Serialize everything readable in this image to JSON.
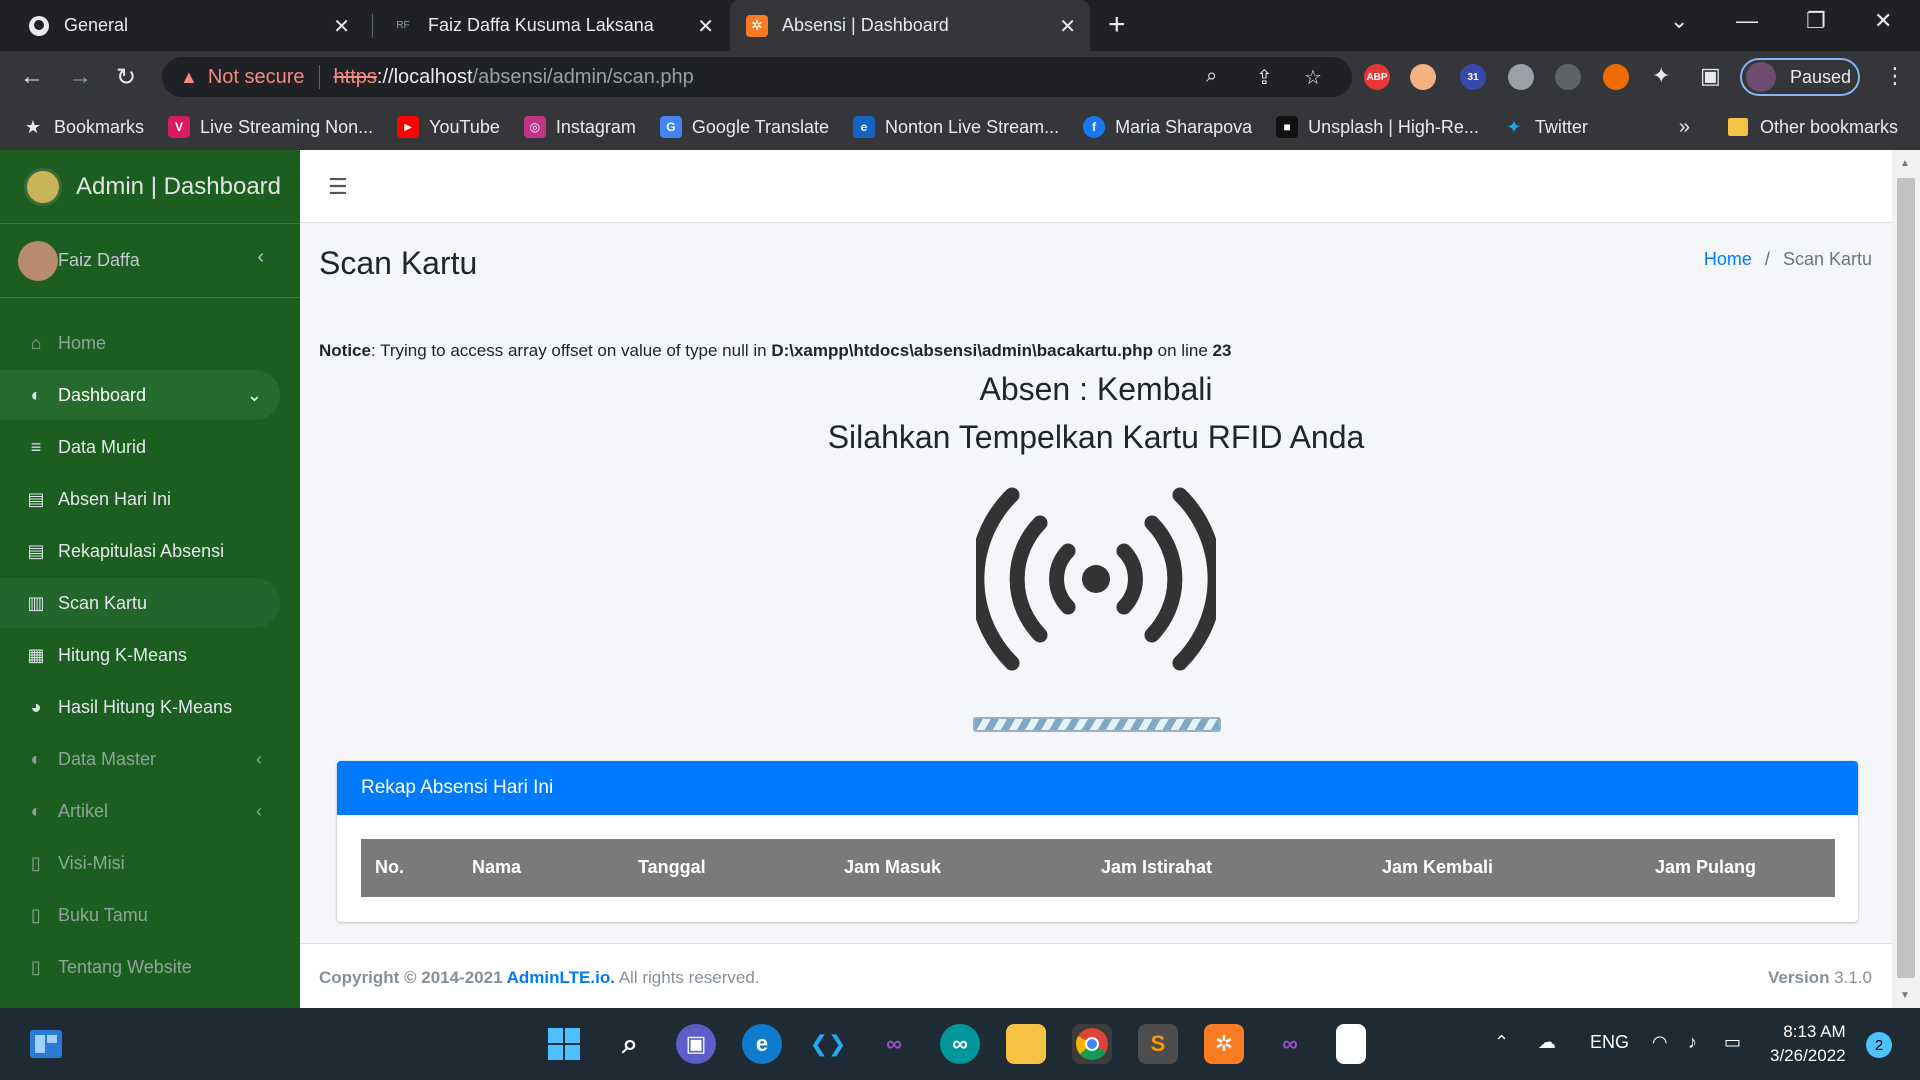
{
  "browser": {
    "tabs": [
      {
        "title": "General",
        "icon": "github-icon"
      },
      {
        "title": "Faiz Daffa Kusuma Laksana",
        "icon": "rf-icon"
      },
      {
        "title": "Absensi | Dashboard",
        "icon": "xampp-icon"
      }
    ],
    "omnibox": {
      "security": "Not secure",
      "scheme": "https",
      "host": "://localhost",
      "path": "/absensi/admin/scan.php"
    },
    "profile_label": "Paused",
    "extension_badge": "31",
    "abp_label": "ABP",
    "bookmarks": [
      {
        "label": "Bookmarks",
        "color": "#35363a",
        "glyph": "★"
      },
      {
        "label": "Live Streaming Non...",
        "color": "#d81b60",
        "glyph": "V"
      },
      {
        "label": "YouTube",
        "color": "#ff0000",
        "glyph": "▶"
      },
      {
        "label": "Instagram",
        "color": "#c13584",
        "glyph": "◎"
      },
      {
        "label": "Google Translate",
        "color": "#4285f4",
        "glyph": "G"
      },
      {
        "label": "Nonton Live Stream...",
        "color": "#1565c0",
        "glyph": "e"
      },
      {
        "label": "Maria Sharapova",
        "color": "#1877f2",
        "glyph": "f"
      },
      {
        "label": "Unsplash | High-Re...",
        "color": "#111111",
        "glyph": "■"
      },
      {
        "label": "Twitter",
        "color": "#1da1f2",
        "glyph": "t"
      }
    ],
    "more_bookmarks": "»",
    "other_bookmarks": "Other bookmarks"
  },
  "sidebar": {
    "brand": "Admin | Dashboard",
    "user": "Faiz Daffa",
    "items": [
      {
        "label": "Home",
        "icon": "home-icon",
        "glyph": "⌂"
      },
      {
        "label": "Dashboard",
        "icon": "dashboard-icon",
        "glyph": "◐"
      },
      {
        "label": "Data Murid",
        "icon": "database-icon",
        "glyph": "≡"
      },
      {
        "label": "Absen Hari Ini",
        "icon": "list-icon",
        "glyph": "▤"
      },
      {
        "label": "Rekapitulasi Absensi",
        "icon": "list-icon",
        "glyph": "▤"
      },
      {
        "label": "Scan Kartu",
        "icon": "barcode-icon",
        "glyph": "▥"
      },
      {
        "label": "Hitung K-Means",
        "icon": "calculator-icon",
        "glyph": "▦"
      },
      {
        "label": "Hasil Hitung K-Means",
        "icon": "pie-chart-icon",
        "glyph": "◕"
      },
      {
        "label": "Data Master",
        "icon": "dashboard-icon",
        "glyph": "◐"
      },
      {
        "label": "Artikel",
        "icon": "dashboard-icon",
        "glyph": "◐"
      },
      {
        "label": "Visi-Misi",
        "icon": "file-icon",
        "glyph": "▯"
      },
      {
        "label": "Buku Tamu",
        "icon": "file-icon",
        "glyph": "▯"
      },
      {
        "label": "Tentang Website",
        "icon": "file-icon",
        "glyph": "▯"
      }
    ]
  },
  "page": {
    "title": "Scan Kartu",
    "breadcrumb_home": "Home",
    "breadcrumb_sep": "/",
    "breadcrumb_current": "Scan Kartu",
    "notice": {
      "label": "Notice",
      "message": ": Trying to access array offset on value of type null in ",
      "file": "D:\\xampp\\htdocs\\absensi\\admin\\bacakartu.php",
      "online": " on line ",
      "line": "23"
    },
    "absen_mode": "Absen : Kembali",
    "instruction": "Silahkan Tempelkan Kartu RFID Anda",
    "card_title": "Rekap Absensi Hari Ini",
    "table_headers": [
      "No.",
      "Nama",
      "Tanggal",
      "Jam Masuk",
      "Jam Istirahat",
      "Jam Kembali",
      "Jam Pulang"
    ]
  },
  "footer": {
    "copyright": "Copyright © 2014-2021 ",
    "brand_link": "AdminLTE.io.",
    "rights": " All rights reserved.",
    "version_label": "Version",
    "version": " 3.1.0"
  },
  "taskbar": {
    "language": "ENG",
    "time": "8:13 AM",
    "date": "3/26/2022",
    "notifications": "2"
  },
  "colors": {
    "sidebar": "#1b5e20",
    "primary": "#007bff",
    "table_head": "#7a7a7a"
  }
}
